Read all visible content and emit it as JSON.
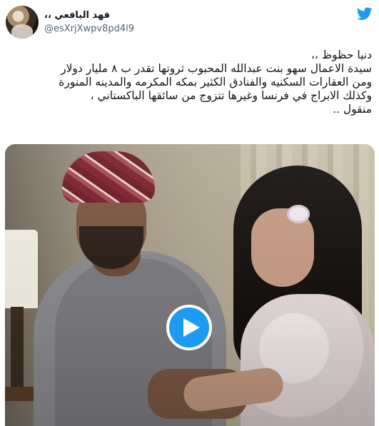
{
  "tweet": {
    "author": {
      "display_name": "فهد اليافعي ،،",
      "handle": "@esXrjXwpv8pd4l9"
    },
    "text_lines": [
      "دنيا حظوظ ،،",
      "سيدة الاعمال سهو بنت عبدالله المحبوب ثروتها تقدر ب ٨ مليار دولار",
      "ومن العقارات السكنيه والفنادق الكثير بمكه المكرمه والمدينه المنورة",
      "وكذلك الابراج في فرنسا وغيرها تتزوج من سائقها الباكستاني ،",
      "منقول .."
    ],
    "media": {
      "type": "video",
      "play_icon": "play-icon"
    }
  },
  "icons": {
    "brand": "twitter-bird-icon"
  },
  "colors": {
    "brand_blue": "#1d9bf0",
    "text_primary": "#0f1419",
    "text_secondary": "#536471"
  }
}
